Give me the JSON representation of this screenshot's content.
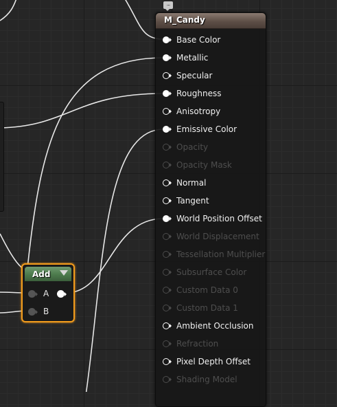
{
  "material_node": {
    "title": "M_Candy",
    "pins": [
      {
        "label": "Base Color",
        "state": "connected"
      },
      {
        "label": "Metallic",
        "state": "connected"
      },
      {
        "label": "Specular",
        "state": "open"
      },
      {
        "label": "Roughness",
        "state": "connected"
      },
      {
        "label": "Anisotropy",
        "state": "open"
      },
      {
        "label": "Emissive Color",
        "state": "connected"
      },
      {
        "label": "Opacity",
        "state": "disabled"
      },
      {
        "label": "Opacity Mask",
        "state": "disabled"
      },
      {
        "label": "Normal",
        "state": "open"
      },
      {
        "label": "Tangent",
        "state": "open"
      },
      {
        "label": "World Position Offset",
        "state": "connected"
      },
      {
        "label": "World Displacement",
        "state": "disabled"
      },
      {
        "label": "Tessellation Multiplier",
        "state": "disabled"
      },
      {
        "label": "Subsurface Color",
        "state": "disabled"
      },
      {
        "label": "Custom Data 0",
        "state": "disabled"
      },
      {
        "label": "Custom Data 1",
        "state": "disabled"
      },
      {
        "label": "Ambient Occlusion",
        "state": "open"
      },
      {
        "label": "Refraction",
        "state": "disabled"
      },
      {
        "label": "Pixel Depth Offset",
        "state": "open"
      },
      {
        "label": "Shading Model",
        "state": "disabled"
      }
    ]
  },
  "add_node": {
    "title": "Add",
    "input_a": "A",
    "input_b": "B",
    "selected": true
  },
  "icons": {
    "comment": "comment-bubble-icon",
    "dropdown": "dropdown-arrow-icon"
  },
  "colors": {
    "background": "#262626",
    "wire": "#e8e8e8",
    "selection_outline": "#f39c1c",
    "material_header": "#5e4f47",
    "add_header": "#4c7a4c",
    "pin_enabled": "#ffffff",
    "pin_disabled": "#4c4c4c"
  }
}
